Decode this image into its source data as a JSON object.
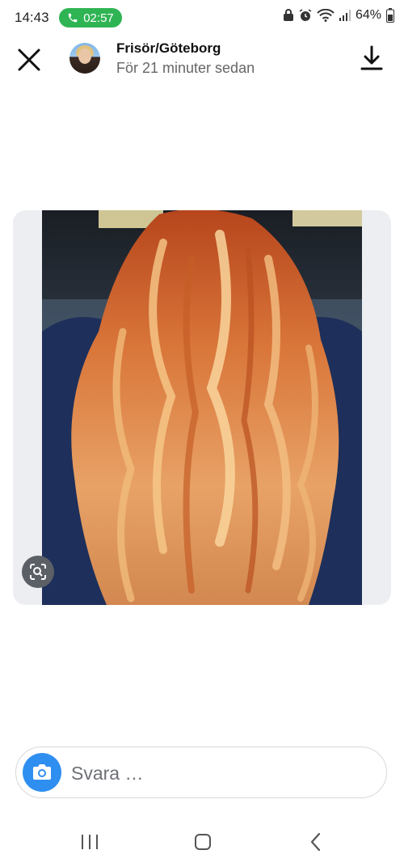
{
  "status_bar": {
    "time": "14:43",
    "call_timer": "02:57",
    "battery": "64%"
  },
  "header": {
    "title": "Frisör/Göteborg",
    "subtitle": "För 21 minuter sedan"
  },
  "reply": {
    "placeholder": "Svara …"
  },
  "colors": {
    "call_green": "#2fb454",
    "camera_blue": "#2f8ff0"
  },
  "icons": [
    "close-icon",
    "download-icon",
    "visual-search-icon",
    "camera-icon",
    "recent-apps-icon",
    "home-icon",
    "back-icon"
  ]
}
